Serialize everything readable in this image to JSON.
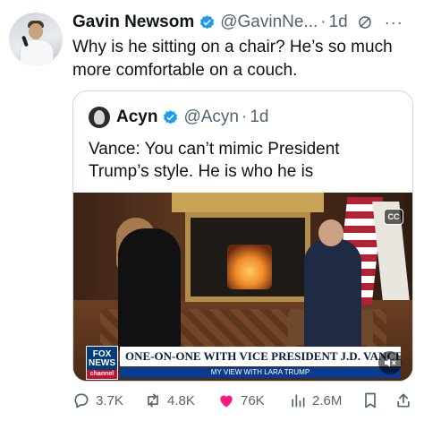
{
  "tweet": {
    "author_name": "Gavin Newsom",
    "author_handle": "@GavinNe...",
    "separator": "·",
    "time": "1d",
    "text": "Why is he sitting on a chair? He’s so much more comfortable on a couch.",
    "more_label": "···"
  },
  "quoted": {
    "author_name": "Acyn",
    "author_handle": "@Acyn",
    "separator": "·",
    "time": "1d",
    "text": "Vance: You can’t mimic President Trump’s style. He is who he is",
    "video": {
      "cc_label": "CC",
      "network_line1": "FOX",
      "network_line2": "NEWS",
      "network_line3": "channel",
      "headline": "ONE-ON-ONE WITH VICE PRESIDENT J.D. VANCE",
      "subline": "MY VIEW WITH LARA TRUMP"
    }
  },
  "actions": {
    "replies": "3.7K",
    "reposts": "4.8K",
    "likes": "76K",
    "views": "2.6M"
  },
  "colors": {
    "verified": "#1d9bf0",
    "like": "#f91880",
    "muted": "#536471"
  },
  "icons": [
    "verified-badge-icon",
    "grok-icon",
    "more-icon",
    "reply-icon",
    "repost-icon",
    "like-icon",
    "views-icon",
    "bookmark-icon",
    "share-icon",
    "mute-icon"
  ]
}
